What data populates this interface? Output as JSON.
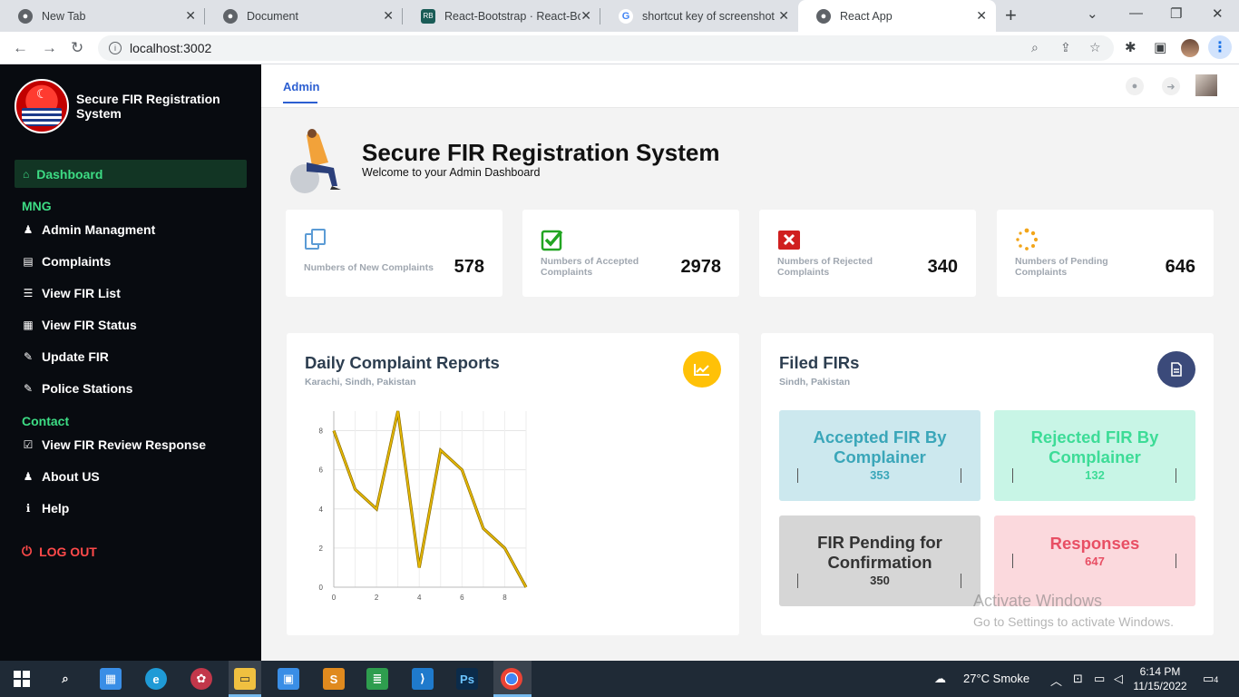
{
  "browser": {
    "tabs": [
      {
        "title": "New Tab",
        "icon": "chrome-icon"
      },
      {
        "title": "Document",
        "icon": "globe-icon"
      },
      {
        "title": "React-Bootstrap · React-Boot",
        "icon": "react-bootstrap-icon"
      },
      {
        "title": "shortcut key of screenshot in",
        "icon": "google-icon"
      },
      {
        "title": "React App",
        "icon": "globe-icon"
      }
    ],
    "url": "localhost:3002"
  },
  "sidebar": {
    "app_title": "Secure FIR Registration System",
    "active_item": "Dashboard",
    "section_mng": "MNG",
    "mng_items": [
      {
        "label": "Admin Managment",
        "icon": "user-icon"
      },
      {
        "label": "Complaints",
        "icon": "document-icon"
      },
      {
        "label": "View FIR List",
        "icon": "list-icon"
      },
      {
        "label": "View FIR Status",
        "icon": "archive-icon"
      },
      {
        "label": "Update FIR",
        "icon": "edit-icon"
      },
      {
        "label": "Police Stations",
        "icon": "edit-icon"
      }
    ],
    "section_contact": "Contact",
    "contact_items": [
      {
        "label": "View FIR Review Response",
        "icon": "calendar-check-icon"
      },
      {
        "label": "About US",
        "icon": "users-icon"
      },
      {
        "label": "Help",
        "icon": "info-icon"
      }
    ],
    "logout": "LOG OUT"
  },
  "header": {
    "tab": "Admin"
  },
  "hero": {
    "title": "Secure FIR Registration System",
    "subtitle": "Welcome to your Admin Dashboard"
  },
  "stats": [
    {
      "label": "Numbers of New Complaints",
      "value": "578",
      "icon": "copy-icon",
      "color": "#5b9bd5"
    },
    {
      "label": "Numbers of Accepted Complaints",
      "value": "2978",
      "icon": "check-square-icon",
      "color": "#22a522"
    },
    {
      "label": "Numbers of Rejected Complaints",
      "value": "340",
      "icon": "x-square-icon",
      "color": "#d01f1f"
    },
    {
      "label": "Numbers of Pending Complaints",
      "value": "646",
      "icon": "spinner-icon",
      "color": "#f2a51a"
    }
  ],
  "daily_card": {
    "title": "Daily Complaint Reports",
    "subtitle": "Karachi, Sindh, Pakistan",
    "badge_color": "#ffc107"
  },
  "chart_data": {
    "type": "line",
    "x": [
      0,
      1,
      2,
      3,
      4,
      5,
      6,
      7,
      8,
      9
    ],
    "series": [
      {
        "values": [
          8,
          5,
          4,
          9,
          1,
          7,
          6,
          3,
          2,
          0
        ]
      }
    ],
    "x_ticks": [
      "0",
      "2",
      "4",
      "6",
      "8"
    ],
    "y_ticks": [
      "0",
      "2",
      "4",
      "6",
      "8"
    ],
    "xlim": [
      0,
      9
    ],
    "ylim": [
      0,
      9
    ],
    "line_color": "#e6b800",
    "grid": true
  },
  "filed_card": {
    "title": "Filed FIRs",
    "subtitle": "Sindh, Pakistan",
    "badge_color": "#3b4a7a",
    "boxes": [
      {
        "title": "Accepted FIR By Complainer",
        "value": "353",
        "bg": "#cce8ee",
        "color": "#3aa6b9"
      },
      {
        "title": "Rejected FIR By Complainer",
        "value": "132",
        "bg": "#c8f5e6",
        "color": "#3ddc97"
      },
      {
        "title": "FIR Pending for Confirmation",
        "value": "350",
        "bg": "#d6d6d6",
        "color": "#333333"
      },
      {
        "title": "Responses",
        "value": "647",
        "bg": "#fbd9dd",
        "color": "#e84f64"
      }
    ]
  },
  "watermark": {
    "line1": "Activate Windows",
    "line2": "Go to Settings to activate Windows."
  },
  "taskbar": {
    "weather": "27°C  Smoke",
    "time": "6:14 PM",
    "date": "11/15/2022",
    "notifications": "4"
  }
}
